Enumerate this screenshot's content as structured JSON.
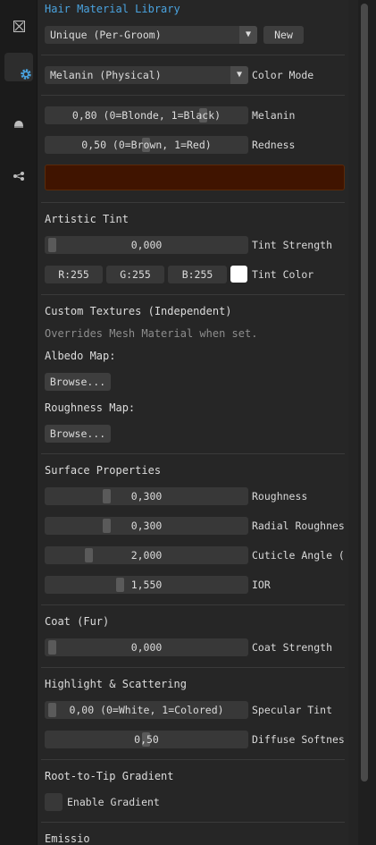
{
  "library": {
    "title": "Hair Material Library",
    "preset_value": "Unique (Per-Groom)",
    "new_button": "New"
  },
  "color_mode": {
    "value": "Melanin (Physical)",
    "label": "Color Mode"
  },
  "melanin": {
    "value": "0,80 (0=Blonde, 1=Black)",
    "label": "Melanin",
    "fraction": 0.8
  },
  "redness": {
    "value": "0,50 (0=Brown, 1=Red)",
    "label": "Redness",
    "fraction": 0.5
  },
  "preview_color": "#401400",
  "artistic_tint": {
    "header": "Artistic Tint",
    "strength_value": "0,000",
    "strength_label": "Tint Strength",
    "r": "R:255",
    "g": "G:255",
    "b": "B:255",
    "color_label": "Tint Color",
    "swatch_color": "#ffffff"
  },
  "custom_textures": {
    "header": "Custom Textures (Independent)",
    "note": "Overrides Mesh Material when set.",
    "albedo_label": "Albedo Map:",
    "albedo_button": "Browse...",
    "roughness_label": "Roughness Map:",
    "roughness_button": "Browse..."
  },
  "surface": {
    "header": "Surface Properties",
    "rows": [
      {
        "value": "0,300",
        "label": "Roughness"
      },
      {
        "value": "0,300",
        "label": "Radial Roughnes"
      },
      {
        "value": "2,000",
        "label": "Cuticle Angle ("
      },
      {
        "value": "1,550",
        "label": "IOR"
      }
    ]
  },
  "coat": {
    "header": "Coat (Fur)",
    "value": "0,000",
    "label": "Coat Strength"
  },
  "highlight": {
    "header": "Highlight & Scattering",
    "specular_value": "0,00 (0=White, 1=Colored)",
    "specular_label": "Specular Tint",
    "diffuse_value": "0,50",
    "diffuse_label": "Diffuse Softnes"
  },
  "gradient": {
    "header": "Root-to-Tip Gradient",
    "enable_label": "Enable Gradient"
  },
  "emission": {
    "header": "Emissio"
  },
  "sidebar": {
    "icons": [
      "close-box-icon",
      "gear-icon",
      "hair-icon",
      "share-nodes-icon"
    ]
  }
}
